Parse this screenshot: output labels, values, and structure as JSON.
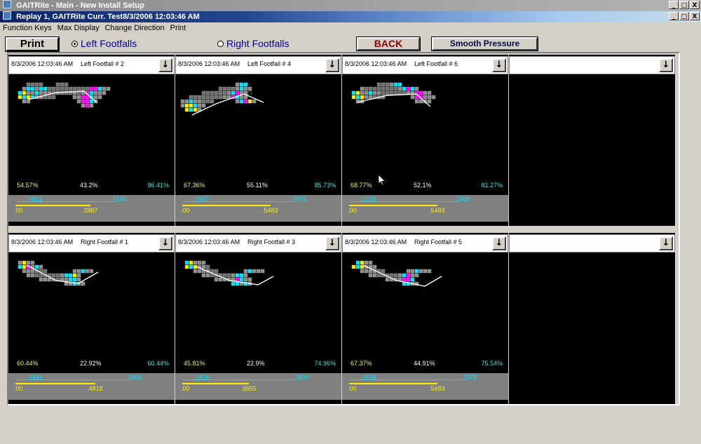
{
  "window": {
    "outer_title": "GAITRite - Main - New Install Setup",
    "inner_title": "Replay 1, GAITRite  Curr. Test8/3/2006 12:03:46 AM",
    "controls": {
      "minimize": "_",
      "restore": "□",
      "close": "X"
    }
  },
  "menu": [
    "Function Keys",
    "Max Display",
    "Change Direction",
    "Print"
  ],
  "toolbar": {
    "print_label": "Print",
    "left_radio": "Left Footfalls",
    "right_radio": "Right Footfalls",
    "selected": "left",
    "back_label": "BACK",
    "smooth_label": "Smooth Pressure"
  },
  "dropdown_icon": "↓",
  "colors": {
    "cyan": "#00d8ff",
    "yellow": "#ffee00",
    "magenta": "#ff00ff",
    "cell_gray": "#8c8c8c",
    "back_text": "#8b0000"
  },
  "rows": [
    {
      "panels": [
        {
          "time": "8/3/2006 12:03:46 AM",
          "label": "Left Footfall # 2",
          "pct_left": "54.57%",
          "pct_mid": "43.2%",
          "pct_right": "86.41%",
          "cyan_left": ".0831",
          "cyan_right": ".7144",
          "yellow_left": ".00",
          "yellow_right": ".3987",
          "cyan_fraction": 0.6,
          "yellow_fraction": 0.45
        },
        {
          "time": "8/3/2006 12:03:46 AM",
          "label": "Left Footfall # 4",
          "pct_left": "67.36%",
          "pct_mid": "55.11%",
          "pct_right": "85.73%",
          "cyan_left": ".0997",
          "cyan_right": ".7975",
          "yellow_left": ".00",
          "yellow_right": ".5483",
          "cyan_fraction": 0.68,
          "yellow_fraction": 0.53
        },
        {
          "time": "8/3/2006 12:03:46 AM",
          "label": "Left Footfall # 6",
          "pct_left": "68.77%",
          "pct_mid": "52.1%",
          "pct_right": "81.27%",
          "cyan_left": ".1329",
          "cyan_right": ".7809",
          "yellow_left": ".00",
          "yellow_right": ".5483",
          "cyan_fraction": 0.66,
          "yellow_fraction": 0.53
        },
        {
          "time": "",
          "label": ""
        }
      ]
    },
    {
      "panels": [
        {
          "time": "8/3/2006 12:03:46 AM",
          "label": "Right Footfall # 1",
          "pct_left": "60.44%",
          "pct_mid": "22.92%",
          "pct_right": "60.44%",
          "cyan_left": ".2991",
          "cyan_right": ".7809",
          "yellow_left": ".00",
          "yellow_right": ".4818",
          "cyan_fraction": 0.69,
          "yellow_fraction": 0.48
        },
        {
          "time": "8/3/2006 12:03:46 AM",
          "label": "Right Footfall # 3",
          "pct_left": "45.81%",
          "pct_mid": "22.9%",
          "pct_right": "74.96%",
          "cyan_left": ".1828",
          "cyan_right": ".7809",
          "yellow_left": ".00",
          "yellow_right": ".3655",
          "cyan_fraction": 0.69,
          "yellow_fraction": 0.4
        },
        {
          "time": "8/3/2006 12:03:46 AM",
          "label": "Right Footfall # 5",
          "pct_left": "67.37%",
          "pct_mid": "44.91%",
          "pct_right": "75.54%",
          "cyan_left": ".1828",
          "cyan_right": ".7975",
          "yellow_left": ".00",
          "yellow_right": ".5483",
          "cyan_fraction": 0.7,
          "yellow_fraction": 0.53
        },
        {
          "time": "",
          "label": ""
        }
      ]
    }
  ]
}
